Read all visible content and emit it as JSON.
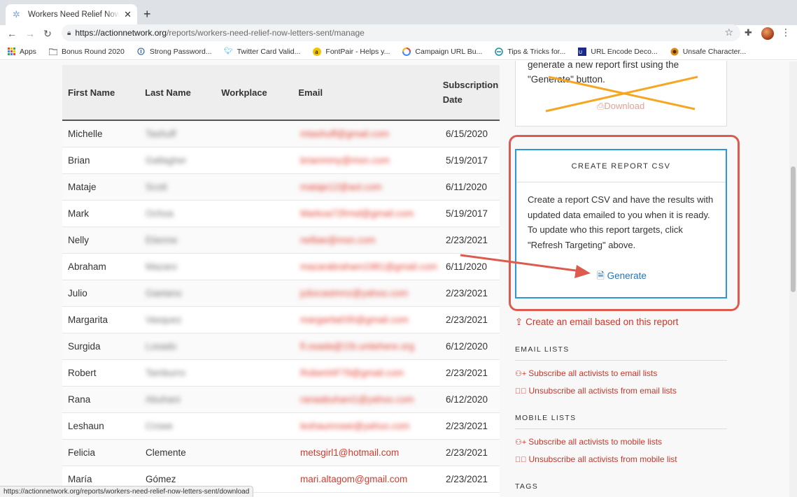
{
  "browser": {
    "tab_title": "Workers Need Relief Now Letters Sent",
    "url_domain": "https://actionnetwork.org",
    "url_path": "/reports/workers-need-relief-now-letters-sent/manage",
    "status_url": "https://actionnetwork.org/reports/workers-need-relief-now-letters-sent/download",
    "bookmarks": [
      {
        "label": "Apps",
        "icon": "apps-grid-icon"
      },
      {
        "label": "Bonus Round 2020",
        "icon": "folder-icon"
      },
      {
        "label": "Strong Password...",
        "icon": "password-icon"
      },
      {
        "label": "Twitter Card Valid...",
        "icon": "twitter-icon"
      },
      {
        "label": "FontPair - Helps y...",
        "icon": "fontpair-icon"
      },
      {
        "label": "Campaign URL Bu...",
        "icon": "google-icon"
      },
      {
        "label": "Tips & Tricks for...",
        "icon": "tips-icon"
      },
      {
        "label": "URL Encode Deco...",
        "icon": "url-encode-icon"
      },
      {
        "label": "Unsafe Character...",
        "icon": "unsafe-char-icon"
      }
    ]
  },
  "table": {
    "headers": [
      "First Name",
      "Last Name",
      "Workplace",
      "Email",
      "Subscription Date"
    ],
    "rows": [
      {
        "first": "Michelle",
        "last": "Tashuff",
        "email": "mtashuff@gmail.com",
        "date": "6/15/2020"
      },
      {
        "first": "Brian",
        "last": "Gallagher",
        "email": "brianmmy@msn.com",
        "date": "5/19/2017"
      },
      {
        "first": "Mataje",
        "last": "Scott",
        "email": "mataje12@aol.com",
        "date": "6/11/2020"
      },
      {
        "first": "Mark",
        "last": "Ochoa",
        "email": "Markoa72frmd@gmail.com",
        "date": "5/19/2017"
      },
      {
        "first": "Nelly",
        "last": "Etienne",
        "email": "nelliae@msn.com",
        "date": "2/23/2021"
      },
      {
        "first": "Abraham",
        "last": "Mazaro",
        "email": "mazarabraham1981@gmail.com",
        "date": "6/11/2020"
      },
      {
        "first": "Julio",
        "last": "Gaetano",
        "email": "juliocastmnz@yahoo.com",
        "date": "2/23/2021"
      },
      {
        "first": "Margarita",
        "last": "Vasquez",
        "email": "margarita035@gmail.com",
        "date": "2/23/2021"
      },
      {
        "first": "Surgida",
        "last": "Losado",
        "email": "fl.osada@15t.unitehere.org",
        "date": "6/12/2020"
      },
      {
        "first": "Robert",
        "last": "Tamburro",
        "email": "RobertAF79@gmail.com",
        "date": "2/23/2021"
      },
      {
        "first": "Rana",
        "last": "Abuhani",
        "email": "ranaabuhani1@yahoo.com",
        "date": "6/12/2020"
      },
      {
        "first": "Leshaun",
        "last": "Crowe",
        "email": "leshaunrowe@yahoo.com",
        "date": "2/23/2021"
      },
      {
        "first": "Felicia",
        "last": "Clemente",
        "email": "metsgirl1@hotmail.com",
        "date": "2/23/2021"
      },
      {
        "first": "María",
        "last": "Gómez",
        "email": "mari.altagom@gmail.com",
        "date": "2/23/2021"
      }
    ]
  },
  "old_report": {
    "text": "generate a new report first using the \"Generate\" button.",
    "download_label": "Download"
  },
  "csv": {
    "title": "CREATE REPORT CSV",
    "text": "Create a report CSV and have the results with updated data emailed to you when it is ready. To update who this report targets, click \"Refresh Targeting\" above.",
    "generate_label": "Generate"
  },
  "sidebar": {
    "create_email": "Create an email based on this report",
    "email_lists_head": "EMAIL LISTS",
    "email_subscribe": "Subscribe all activists to email lists",
    "email_unsubscribe": "Unsubscribe all activists from email lists",
    "mobile_lists_head": "MOBILE LISTS",
    "mobile_subscribe": "Subscribe all activists to mobile lists",
    "mobile_unsubscribe": "Unsubscribe all activists from mobile list",
    "tags_head": "TAGS"
  },
  "colors": {
    "link_red": "#c8372b",
    "generate_blue": "#2576b8",
    "box_blue": "#2b97d8",
    "annotation_red": "#dc5a4e",
    "cross_orange": "#f5a623"
  }
}
